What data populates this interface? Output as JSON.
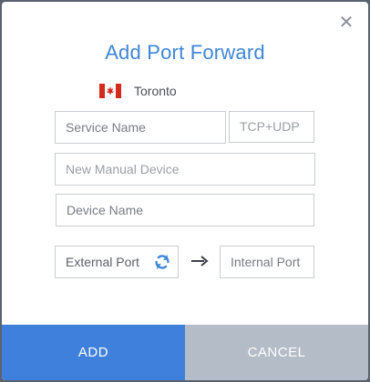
{
  "dialog": {
    "title": "Add Port Forward",
    "close_icon": "close-icon",
    "location": {
      "flag_icon": "canada-flag-icon",
      "name": "Toronto"
    }
  },
  "form": {
    "service_name": {
      "placeholder": "Service Name",
      "value": ""
    },
    "protocol": {
      "value": "TCP+UDP"
    },
    "device": {
      "placeholder": "New Manual Device",
      "value": ""
    },
    "device_name": {
      "placeholder": "Device Name",
      "value": ""
    },
    "external_port": {
      "placeholder": "External Port",
      "value": ""
    },
    "internal_port": {
      "placeholder": "Internal Port",
      "value": ""
    },
    "refresh_icon": "refresh-icon",
    "arrow_icon": "arrow-right-icon"
  },
  "buttons": {
    "add": "ADD",
    "cancel": "CANCEL"
  },
  "colors": {
    "accent": "#3f80dd",
    "cancel": "#b4bcc8",
    "flag_red": "#d52b1e"
  }
}
